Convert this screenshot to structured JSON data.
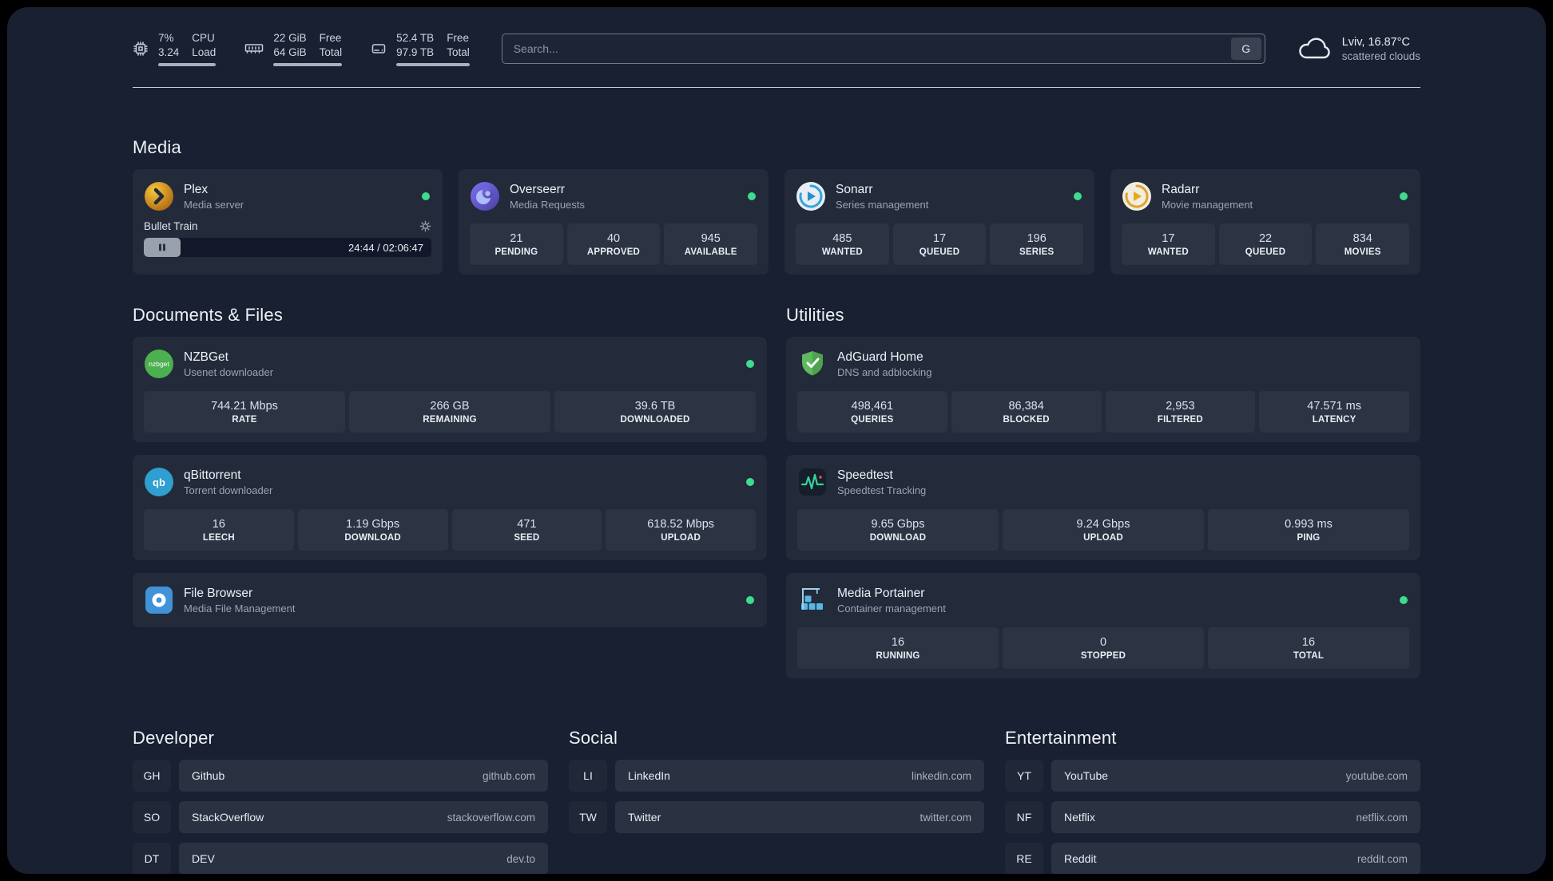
{
  "header": {
    "resources": [
      {
        "icon": "cpu-icon",
        "values": [
          "7%",
          "3.24"
        ],
        "labels": [
          "CPU",
          "Load"
        ]
      },
      {
        "icon": "memory-icon",
        "values": [
          "22 GiB",
          "64 GiB"
        ],
        "labels": [
          "Free",
          "Total"
        ]
      },
      {
        "icon": "disk-icon",
        "values": [
          "52.4 TB",
          "97.9 TB"
        ],
        "labels": [
          "Free",
          "Total"
        ]
      }
    ],
    "search": {
      "placeholder": "Search...",
      "button_label": "G"
    },
    "weather": {
      "location": "Lviv, 16.87°C",
      "condition": "scattered clouds"
    }
  },
  "media": {
    "title": "Media",
    "plex": {
      "name": "Plex",
      "subtitle": "Media server",
      "now_playing": "Bullet Train",
      "time": "24:44 / 02:06:47"
    },
    "overseerr": {
      "name": "Overseerr",
      "subtitle": "Media Requests",
      "stats": [
        {
          "value": "21",
          "label": "PENDING"
        },
        {
          "value": "40",
          "label": "APPROVED"
        },
        {
          "value": "945",
          "label": "AVAILABLE"
        }
      ]
    },
    "sonarr": {
      "name": "Sonarr",
      "subtitle": "Series management",
      "stats": [
        {
          "value": "485",
          "label": "WANTED"
        },
        {
          "value": "17",
          "label": "QUEUED"
        },
        {
          "value": "196",
          "label": "SERIES"
        }
      ]
    },
    "radarr": {
      "name": "Radarr",
      "subtitle": "Movie management",
      "stats": [
        {
          "value": "17",
          "label": "WANTED"
        },
        {
          "value": "22",
          "label": "QUEUED"
        },
        {
          "value": "834",
          "label": "MOVIES"
        }
      ]
    }
  },
  "documents": {
    "title": "Documents & Files",
    "nzbget": {
      "name": "NZBGet",
      "subtitle": "Usenet downloader",
      "stats": [
        {
          "value": "744.21 Mbps",
          "label": "RATE"
        },
        {
          "value": "266 GB",
          "label": "REMAINING"
        },
        {
          "value": "39.6 TB",
          "label": "DOWNLOADED"
        }
      ]
    },
    "qbittorrent": {
      "name": "qBittorrent",
      "subtitle": "Torrent downloader",
      "stats": [
        {
          "value": "16",
          "label": "LEECH"
        },
        {
          "value": "1.19 Gbps",
          "label": "DOWNLOAD"
        },
        {
          "value": "471",
          "label": "SEED"
        },
        {
          "value": "618.52 Mbps",
          "label": "UPLOAD"
        }
      ]
    },
    "filebrowser": {
      "name": "File Browser",
      "subtitle": "Media File Management"
    }
  },
  "utilities": {
    "title": "Utilities",
    "adguard": {
      "name": "AdGuard Home",
      "subtitle": "DNS and adblocking",
      "stats": [
        {
          "value": "498,461",
          "label": "QUERIES"
        },
        {
          "value": "86,384",
          "label": "BLOCKED"
        },
        {
          "value": "2,953",
          "label": "FILTERED"
        },
        {
          "value": "47.571 ms",
          "label": "LATENCY"
        }
      ]
    },
    "speedtest": {
      "name": "Speedtest",
      "subtitle": "Speedtest Tracking",
      "stats": [
        {
          "value": "9.65 Gbps",
          "label": "DOWNLOAD"
        },
        {
          "value": "9.24 Gbps",
          "label": "UPLOAD"
        },
        {
          "value": "0.993 ms",
          "label": "PING"
        }
      ]
    },
    "portainer": {
      "name": "Media Portainer",
      "subtitle": "Container management",
      "stats": [
        {
          "value": "16",
          "label": "RUNNING"
        },
        {
          "value": "0",
          "label": "STOPPED"
        },
        {
          "value": "16",
          "label": "TOTAL"
        }
      ]
    }
  },
  "bookmarks": {
    "developer": {
      "title": "Developer",
      "items": [
        {
          "abbr": "GH",
          "name": "Github",
          "url": "github.com"
        },
        {
          "abbr": "SO",
          "name": "StackOverflow",
          "url": "stackoverflow.com"
        },
        {
          "abbr": "DT",
          "name": "DEV",
          "url": "dev.to"
        }
      ]
    },
    "social": {
      "title": "Social",
      "items": [
        {
          "abbr": "LI",
          "name": "LinkedIn",
          "url": "linkedin.com"
        },
        {
          "abbr": "TW",
          "name": "Twitter",
          "url": "twitter.com"
        }
      ]
    },
    "entertainment": {
      "title": "Entertainment",
      "items": [
        {
          "abbr": "YT",
          "name": "YouTube",
          "url": "youtube.com"
        },
        {
          "abbr": "NF",
          "name": "Netflix",
          "url": "netflix.com"
        },
        {
          "abbr": "RE",
          "name": "Reddit",
          "url": "reddit.com"
        }
      ]
    }
  }
}
